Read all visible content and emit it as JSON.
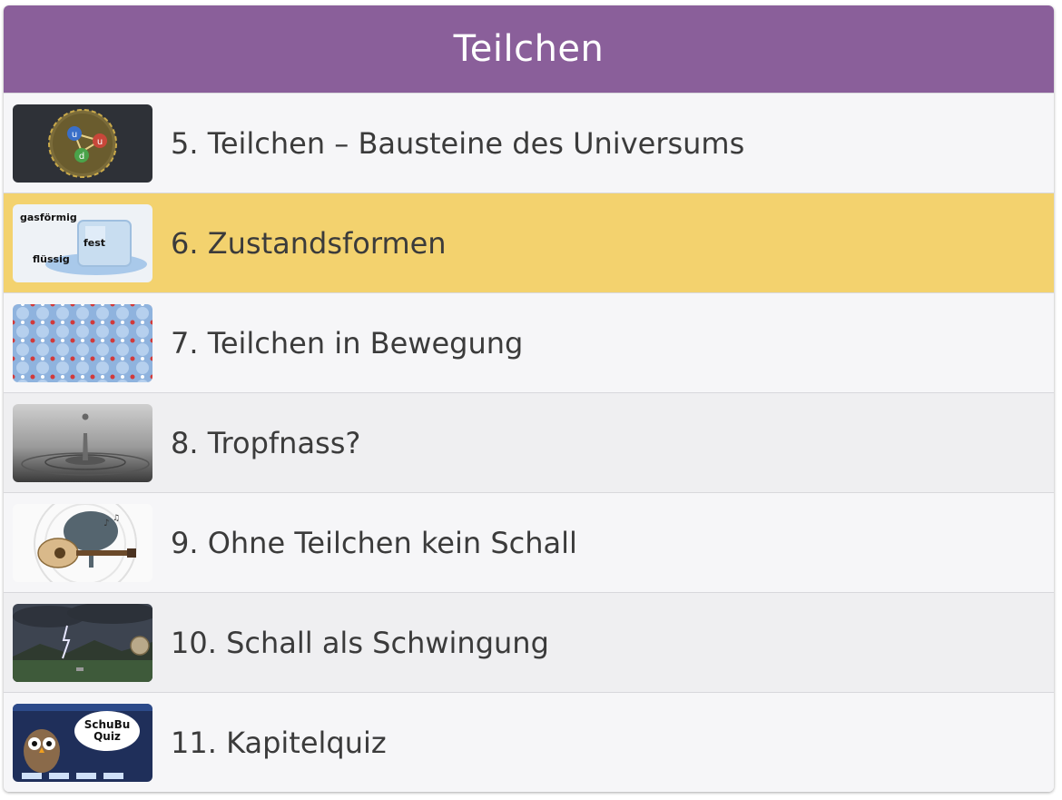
{
  "header": {
    "title": "Teilchen"
  },
  "items": [
    {
      "label": "5. Teilchen – Bausteine des Universums",
      "icon": "quark-atom-icon"
    },
    {
      "label": "6. Zustandsformen",
      "icon": "ice-cube-states-icon",
      "selected": true,
      "thumb_text": {
        "gas": "gasförmig",
        "solid": "fest",
        "liquid": "flüssig"
      }
    },
    {
      "label": "7. Teilchen in Bewegung",
      "icon": "particle-lattice-icon"
    },
    {
      "label": "8. Tropfnass?",
      "icon": "water-drop-icon"
    },
    {
      "label": "9. Ohne Teilchen kein Schall",
      "icon": "guitar-sound-icon"
    },
    {
      "label": "10. Schall als Schwingung",
      "icon": "thunderstorm-icon"
    },
    {
      "label": "11. Kapitelquiz",
      "icon": "quiz-owl-icon",
      "thumb_text": {
        "line1": "SchuBu",
        "line2": "Quiz"
      }
    }
  ],
  "colors": {
    "header": "#8a5f9a",
    "selected": "#f3d26e",
    "text": "#3b3b3b"
  }
}
